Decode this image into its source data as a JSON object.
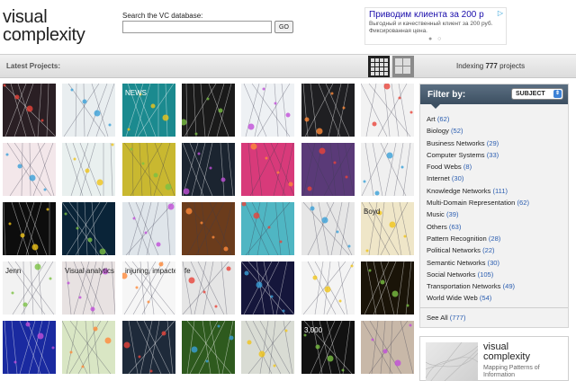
{
  "logo": {
    "line1": "visual",
    "line2": "complexity"
  },
  "search": {
    "label": "Search the VC database:",
    "value": "",
    "placeholder": "",
    "go_label": "GO"
  },
  "ad": {
    "title": "Приводим клиента за 200 р",
    "text": "Выгодный и качественный клиент за 200 руб. Фиксированная цена.",
    "mark": "▷",
    "dots": "● ○"
  },
  "latest": {
    "label": "Latest Projects:"
  },
  "indexing": {
    "prefix": "Indexing",
    "count": "777",
    "suffix": "projects"
  },
  "filter": {
    "title": "Filter by:",
    "selected": "SUBJECT",
    "categories": [
      {
        "name": "Art",
        "count": "(62)"
      },
      {
        "name": "Biology",
        "count": "(52)"
      },
      {
        "name": "Business Networks",
        "count": "(29)"
      },
      {
        "name": "Computer Systems",
        "count": "(33)"
      },
      {
        "name": "Food Webs",
        "count": "(8)"
      },
      {
        "name": "Internet",
        "count": "(30)"
      },
      {
        "name": "Knowledge Networks",
        "count": "(111)"
      },
      {
        "name": "Multi-Domain Representation",
        "count": "(62)"
      },
      {
        "name": "Music",
        "count": "(39)"
      },
      {
        "name": "Others",
        "count": "(63)"
      },
      {
        "name": "Pattern Recognition",
        "count": "(28)"
      },
      {
        "name": "Political Networks",
        "count": "(22)"
      },
      {
        "name": "Semantic Networks",
        "count": "(30)"
      },
      {
        "name": "Social Networks",
        "count": "(105)"
      },
      {
        "name": "Transportation Networks",
        "count": "(49)"
      },
      {
        "name": "World Wide Web",
        "count": "(54)"
      }
    ],
    "see_all": {
      "label": "See All",
      "count": "(777)"
    }
  },
  "promo": {
    "title_line1": "visual",
    "title_line2": "complexity",
    "subtitle": "Mapping Patterns of Information"
  },
  "thumb_colors": [
    [
      "#2a1f24",
      "#e9eef0",
      "#1b8a8f",
      "#1a1a1a",
      "#eef1f4",
      "#1f1f22",
      "#f2f2f2"
    ],
    [
      "#f3e7ea",
      "#e9f0ef",
      "#c9b830",
      "#1b2430",
      "#d83a7a",
      "#5a3a78",
      "#f0f0f0"
    ],
    [
      "#0d0d0d",
      "#0a2438",
      "#dfe5ea",
      "#6b3c1c",
      "#4fb6c3",
      "#e6e6e6",
      "#efe6c8"
    ],
    [
      "#f2f2f2",
      "#e8e2e2",
      "#f6f6f6",
      "#e5e5e5",
      "#15163b",
      "#f4f4f4",
      "#1a1408"
    ],
    [
      "#1a2aa0",
      "#d9e6c4",
      "#1e2a3a",
      "#2e5a1e",
      "#d9dcd4",
      "#111",
      "#c8b8a8"
    ]
  ],
  "thumb_texts": [
    [
      "",
      "",
      "NEWS",
      "",
      "",
      "",
      ""
    ],
    [
      "",
      "",
      "",
      "",
      "",
      "",
      ""
    ],
    [
      "",
      "",
      "",
      "",
      "",
      "",
      "Boyd"
    ],
    [
      "Jenn",
      "Visual analytics",
      "injuring, impacted",
      "fe",
      "",
      "",
      ""
    ],
    [
      "",
      "",
      "",
      "",
      "",
      "3,000",
      ""
    ]
  ]
}
